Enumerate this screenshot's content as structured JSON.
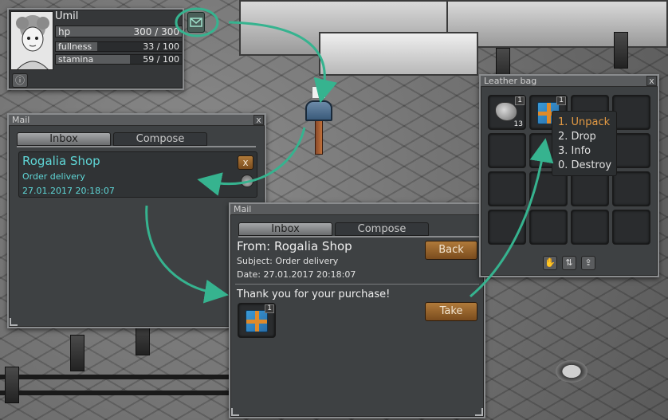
{
  "player": {
    "name": "Umil",
    "stats": [
      {
        "label": "hp",
        "value": "300 / 300",
        "fraction": 1.0
      },
      {
        "label": "fullness",
        "value": "33 / 100",
        "fraction": 0.33
      },
      {
        "label": "stamina",
        "value": "59 / 100",
        "fraction": 0.59
      }
    ],
    "info_icon": "info-icon",
    "mail_icon": "envelope-icon"
  },
  "mail_window": {
    "title": "Mail",
    "close": "x",
    "tabs": [
      "Inbox",
      "Compose"
    ],
    "message": {
      "sender": "Rogalia Shop",
      "subject": "Order delivery",
      "date": "27.01.2017 20:18:07",
      "delete_label": "x",
      "icon": "pouch-icon"
    }
  },
  "mail_read": {
    "title": "Mail",
    "tabs": [
      "Inbox",
      "Compose"
    ],
    "from": "From: Rogalia Shop",
    "subject": "Subject: Order delivery",
    "date": "Date: 27.01.2017 20:18:07",
    "back_label": "Back",
    "body": "Thank you for your purchase!",
    "take_label": "Take",
    "attachment_qty": "1",
    "attachment_icon": "gift-box-icon"
  },
  "bag": {
    "title": "Leather bag",
    "close": "x",
    "slot1_qty": "1",
    "slot1_stack": "13",
    "slot2_qty": "1",
    "menu": [
      "1. Unpack",
      "2. Drop",
      "3. Info",
      "0. Destroy"
    ],
    "footer_icons": [
      "hand-icon",
      "sort-icon",
      "export-icon"
    ]
  },
  "colors": {
    "accent_teal": "#36b38f",
    "menu_highlight": "#e39a44",
    "sender_teal": "#5fd7d7",
    "button_brown": "#9a6530"
  }
}
